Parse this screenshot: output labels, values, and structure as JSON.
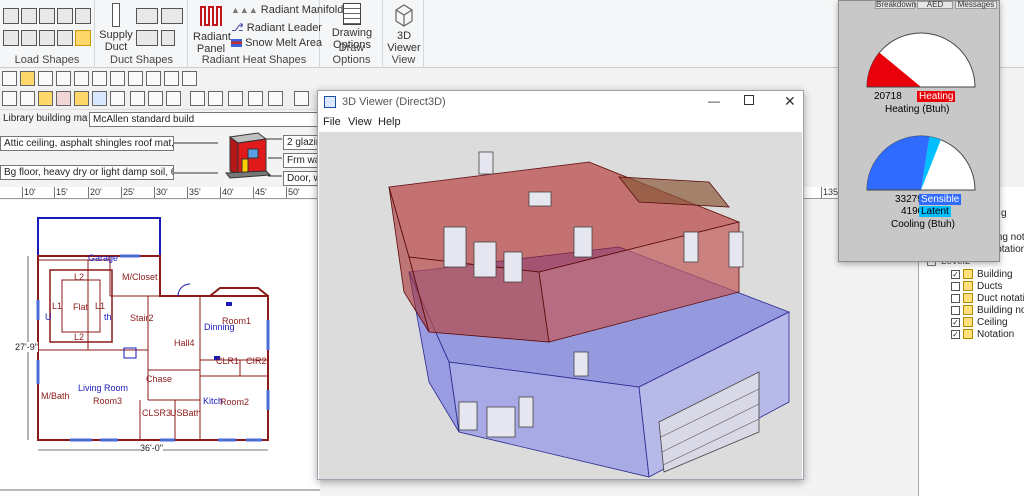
{
  "ribbon": {
    "groups": [
      {
        "label": "Load Shapes"
      },
      {
        "label": "Duct Shapes"
      },
      {
        "label": "Radiant Heat Shapes"
      },
      {
        "label": "Draw Options"
      },
      {
        "label": "View"
      }
    ],
    "supply_duct": "Supply\nDuct",
    "radiant_panel": "Radiant\nPanel",
    "radiant_manifold": "Radiant Manifold",
    "radiant_leader": "Radiant Leader",
    "snow_melt_area": "Snow Melt Area",
    "drawing_options": "Drawing\nOptions",
    "viewer_3d": "3D\nViewer"
  },
  "materials": {
    "library_label": "Library building materials",
    "library_value": "McAllen standard build",
    "ceiling": "Attic ceiling, asphalt shingles roof mat, r-20 roof i",
    "floor": "Bg floor, heavy dry or light damp soil, 6' depth",
    "glazing": "2 glazing,",
    "wall": "Frm wall,",
    "door": "Door, wd"
  },
  "ruler": {
    "ticks": [
      "10'",
      "15'",
      "20'",
      "25'",
      "30'",
      "35'",
      "40'",
      "45'",
      "50'",
      "135"
    ]
  },
  "plan": {
    "rooms": [
      "Garage",
      "M/Closet",
      "L2",
      "L1",
      "Flat",
      "L1",
      "L2",
      "Stair2",
      "Room1",
      "Dinning",
      "Hall4",
      "CLR1",
      "CIR2",
      "Chase",
      "Living Room",
      "Room3",
      "M/Bath",
      "Kitch",
      "Room2",
      "CLSR3",
      "USBath",
      "U",
      "th"
    ],
    "dim_vertical": "27'-9\"",
    "dim_horizontal": "36'-0\""
  },
  "viewer": {
    "title": "3D Viewer (Direct3D)",
    "menu": [
      "File",
      "View",
      "Help"
    ]
  },
  "gauges": {
    "tabs": [
      "Breakdown",
      "AED",
      "Messages"
    ],
    "heating_value": "20718",
    "heating_badge": "Heating",
    "heating_caption": "Heating (Btuh)",
    "sensible_value": "33279",
    "sensible_badge": "Sensible",
    "latent_value": "4190",
    "latent_badge": "Latent",
    "cooling_caption": "Cooling (Btuh)",
    "heating_fraction": 0.22,
    "cooling_sensible_fraction": 0.55,
    "cooling_latent_fraction": 0.07
  },
  "layers": {
    "partial": [
      "g",
      "ding nota",
      "Notation"
    ],
    "level_label": "Level2",
    "items": [
      {
        "label": "Building",
        "checked": true
      },
      {
        "label": "Ducts",
        "checked": false
      },
      {
        "label": "Duct notatio",
        "checked": false
      },
      {
        "label": "Building nota",
        "checked": false
      },
      {
        "label": "Ceiling",
        "checked": true
      },
      {
        "label": "Notation",
        "checked": true
      }
    ]
  },
  "colors": {
    "heating": "#e8000a",
    "sensible": "#2f6bff",
    "latent": "#00bfff",
    "wall_outline": "#8b1a1a",
    "plan_blue": "#1a1ab8"
  }
}
